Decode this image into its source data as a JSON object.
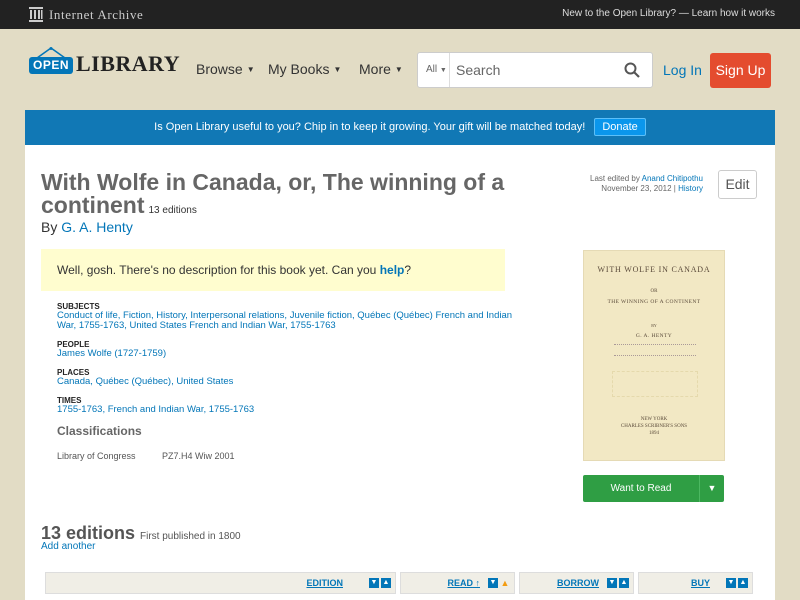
{
  "ia_bar": {
    "logo_text": "Internet Archive",
    "new_text": "New to the Open Library?",
    "learn_link": "Learn how it works"
  },
  "header": {
    "logo_open": "OPEN",
    "logo_library": "LIBRARY",
    "nav": [
      {
        "label": "Browse"
      },
      {
        "label": "My Books"
      },
      {
        "label": "More"
      }
    ],
    "search": {
      "facet": "All",
      "placeholder": "Search"
    },
    "login": "Log In",
    "signup": "Sign Up"
  },
  "banner": {
    "text": "Is Open Library useful to you? Chip in to keep it growing. Your gift will be matched today!",
    "donate": "Donate"
  },
  "book": {
    "title": "With Wolfe in Canada, or, The winning of a continent",
    "editions_count": "13 editions",
    "by": "By",
    "author": "G. A. Henty",
    "last_edited_label": "Last edited by",
    "last_edited_user": "Anand Chitipothu",
    "last_edited_date": "November 23, 2012 |",
    "history": "History",
    "edit": "Edit",
    "no_desc": "Well, gosh. There's no description for this book yet. Can you",
    "help": "help",
    "no_desc_end": "?"
  },
  "facts": {
    "subjects_label": "SUBJECTS",
    "subjects": [
      "Conduct of life",
      "Fiction",
      "History",
      "Interpersonal relations",
      "Juvenile fiction",
      "Québec (Québec) French and Indian War, 1755-1763",
      "United States French and Indian War, 1755-1763"
    ],
    "people_label": "PEOPLE",
    "people": [
      "James Wolfe (1727-1759)"
    ],
    "places_label": "PLACES",
    "places": [
      "Canada",
      "Québec (Québec)",
      "United States"
    ],
    "times_label": "TIMES",
    "times": [
      "1755-1763",
      "French and Indian War, 1755-1763"
    ],
    "classifications": "Classifications",
    "loc_label": "Library of Congress",
    "loc_value": "PZ7.H4 Wiw 2001"
  },
  "cover": {
    "line1": "WITH WOLFE IN CANADA",
    "line2": "OR",
    "line3": "THE WINNING OF A CONTINENT",
    "line4": "BY",
    "line5": "G. A. HENTY",
    "pub1": "NEW YORK",
    "pub2": "CHARLES SCRIBNER'S SONS",
    "pub3": "1894"
  },
  "want_to_read": "Want to Read",
  "editions": {
    "heading": "13 editions",
    "first_published": "First published in 1800",
    "add_another": "Add another",
    "columns": [
      "EDITION",
      "READ",
      "BORROW",
      "BUY"
    ]
  }
}
